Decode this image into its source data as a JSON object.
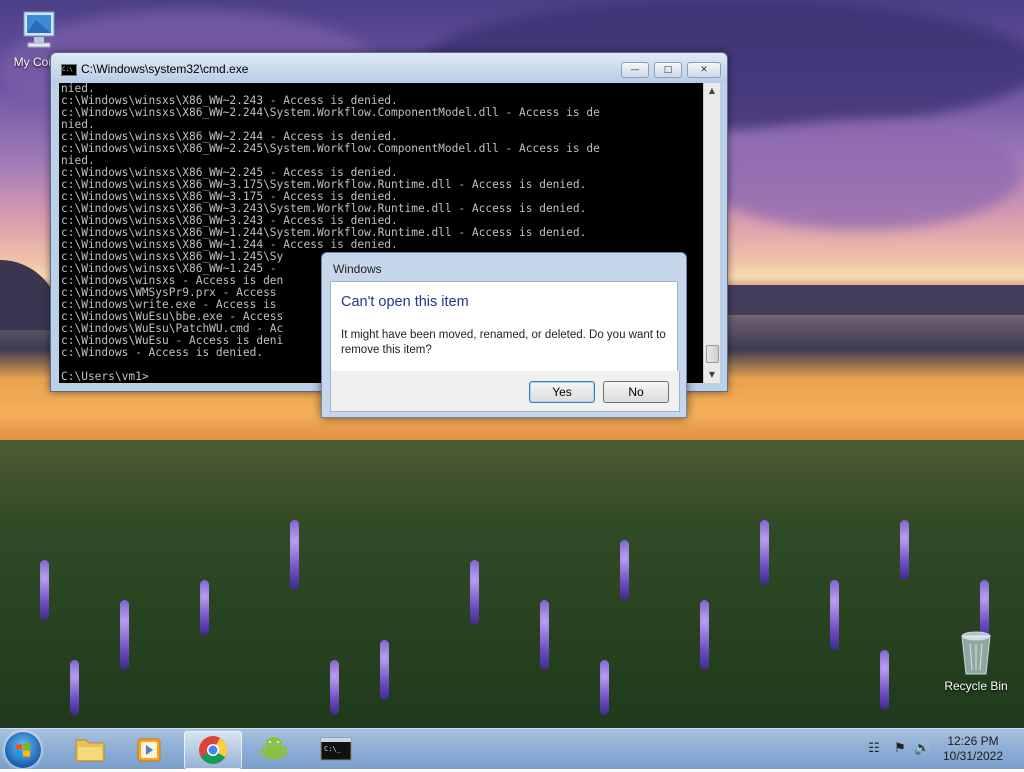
{
  "desktop": {
    "icons": [
      {
        "label": "My Com",
        "icon": "computer-icon"
      },
      {
        "label": "Recycle Bin",
        "icon": "recycle-bin-icon"
      }
    ]
  },
  "cmd_window": {
    "title": "C:\\Windows\\system32\\cmd.exe",
    "lines": [
      "nied.",
      "c:\\Windows\\winsxs\\X86_WW~2.243 - Access is denied.",
      "c:\\Windows\\winsxs\\X86_WW~2.244\\System.Workflow.ComponentModel.dll - Access is de",
      "nied.",
      "c:\\Windows\\winsxs\\X86_WW~2.244 - Access is denied.",
      "c:\\Windows\\winsxs\\X86_WW~2.245\\System.Workflow.ComponentModel.dll - Access is de",
      "nied.",
      "c:\\Windows\\winsxs\\X86_WW~2.245 - Access is denied.",
      "c:\\Windows\\winsxs\\X86_WW~3.175\\System.Workflow.Runtime.dll - Access is denied.",
      "c:\\Windows\\winsxs\\X86_WW~3.175 - Access is denied.",
      "c:\\Windows\\winsxs\\X86_WW~3.243\\System.Workflow.Runtime.dll - Access is denied.",
      "c:\\Windows\\winsxs\\X86_WW~3.243 - Access is denied.",
      "c:\\Windows\\winsxs\\X86_WW~1.244\\System.Workflow.Runtime.dll - Access is denied.",
      "c:\\Windows\\winsxs\\X86_WW~1.244 - Access is denied.",
      "c:\\Windows\\winsxs\\X86_WW~1.245\\Sy",
      "c:\\Windows\\winsxs\\X86_WW~1.245 -",
      "c:\\Windows\\winsxs - Access is den",
      "c:\\Windows\\WMSysPr9.prx - Access",
      "c:\\Windows\\write.exe - Access is",
      "c:\\Windows\\WuEsu\\bbe.exe - Access",
      "c:\\Windows\\WuEsu\\PatchWU.cmd - Ac",
      "c:\\Windows\\WuEsu - Access is deni",
      "c:\\Windows - Access is denied.",
      "",
      "C:\\Users\\vm1>"
    ],
    "buttons": {
      "minimize": "minimize",
      "maximize": "maximize",
      "close": "close"
    }
  },
  "dialog": {
    "title": "Windows",
    "heading": "Can't open this item",
    "message": "It might have been moved, renamed, or deleted. Do you want to remove this item?",
    "yes_label": "Yes",
    "no_label": "No"
  },
  "taskbar": {
    "apps": [
      {
        "name": "windows-explorer",
        "icon": "folder-icon"
      },
      {
        "name": "media-player",
        "icon": "media-player-icon"
      },
      {
        "name": "chrome",
        "icon": "chrome-icon",
        "active": true
      },
      {
        "name": "android",
        "icon": "android-icon"
      },
      {
        "name": "cmd",
        "icon": "cmd-icon"
      }
    ],
    "tray": [
      "network-icon",
      "action-center-icon",
      "volume-icon"
    ],
    "time": "12:26 PM",
    "date": "10/31/2022"
  },
  "colors": {
    "dialog_heading": "#1e3a8a",
    "console_bg": "#000000",
    "console_fg": "#c0c0c0"
  }
}
